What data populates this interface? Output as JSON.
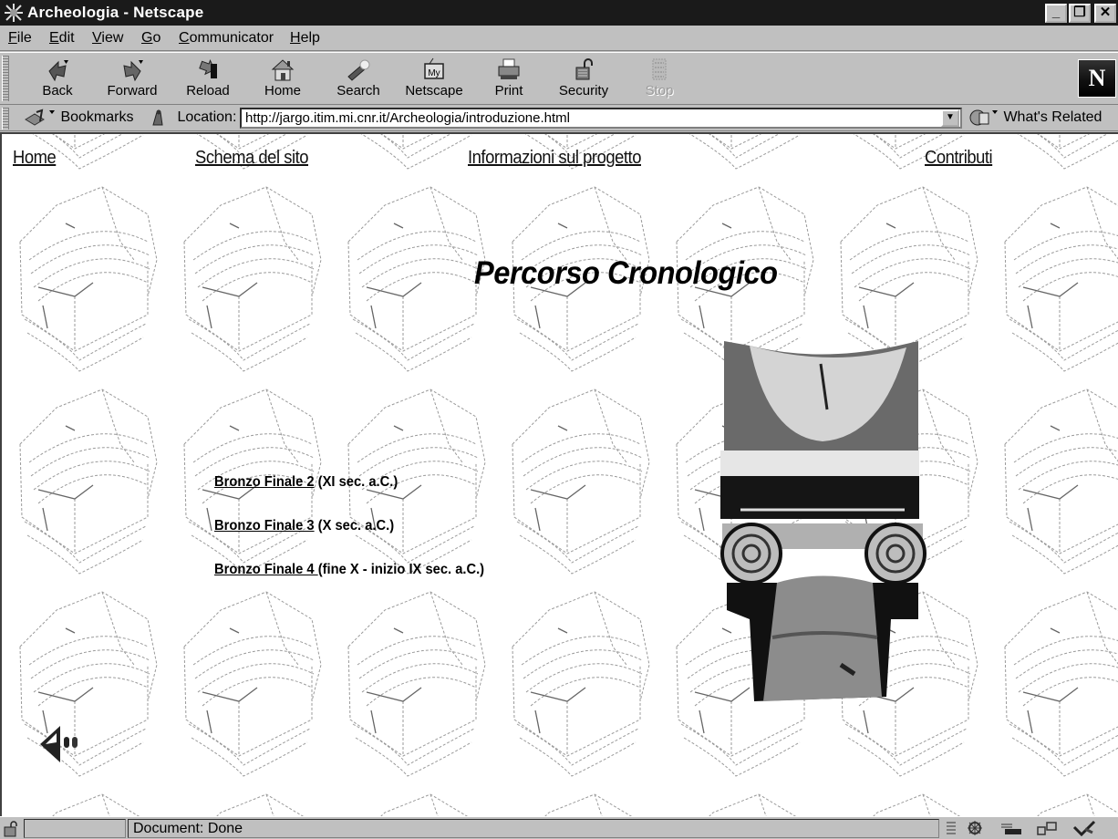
{
  "window": {
    "title": "Archeologia - Netscape",
    "controls": {
      "minimize": "_",
      "maximize": "❐",
      "close": "✕"
    }
  },
  "menu": [
    "File",
    "Edit",
    "View",
    "Go",
    "Communicator",
    "Help"
  ],
  "toolbar": {
    "buttons": [
      {
        "label": "Back",
        "icon": "back-icon",
        "enabled": true
      },
      {
        "label": "Forward",
        "icon": "forward-icon",
        "enabled": true
      },
      {
        "label": "Reload",
        "icon": "reload-icon",
        "enabled": true
      },
      {
        "label": "Home",
        "icon": "home-icon",
        "enabled": true
      },
      {
        "label": "Search",
        "icon": "search-icon",
        "enabled": true
      },
      {
        "label": "Netscape",
        "icon": "my-netscape-icon",
        "enabled": true
      },
      {
        "label": "Print",
        "icon": "printer-icon",
        "enabled": true
      },
      {
        "label": "Security",
        "icon": "padlock-icon",
        "enabled": true
      },
      {
        "label": "Stop",
        "icon": "stop-icon",
        "enabled": false
      }
    ],
    "logo": "N"
  },
  "location_bar": {
    "bookmarks_label": "Bookmarks",
    "location_label": "Location:",
    "url": "http://jargo.itim.mi.cnr.it/Archeologia/introduzione.html",
    "whats_related_label": "What's Related"
  },
  "page": {
    "nav": [
      "Home",
      "Schema del sito",
      "Informazioni sul progetto",
      "Contributi"
    ],
    "heading": "Percorso Cronologico",
    "periods": [
      {
        "link": "Bronzo Finale 2",
        "detail": " (XI sec. a.C.)"
      },
      {
        "link": "Bronzo Finale 3",
        "detail": " (X sec. a.C.)"
      },
      {
        "link": "Bronzo Finale 4 ",
        "detail": "(fine X - inizio IX sec. a.C.)"
      }
    ],
    "images": {
      "background": "ancient-building-sketch-tile",
      "illustration": "ionic-capital-sundial",
      "back_nav": "back-arrow-icon"
    }
  },
  "status": {
    "text": "Document: Done"
  }
}
